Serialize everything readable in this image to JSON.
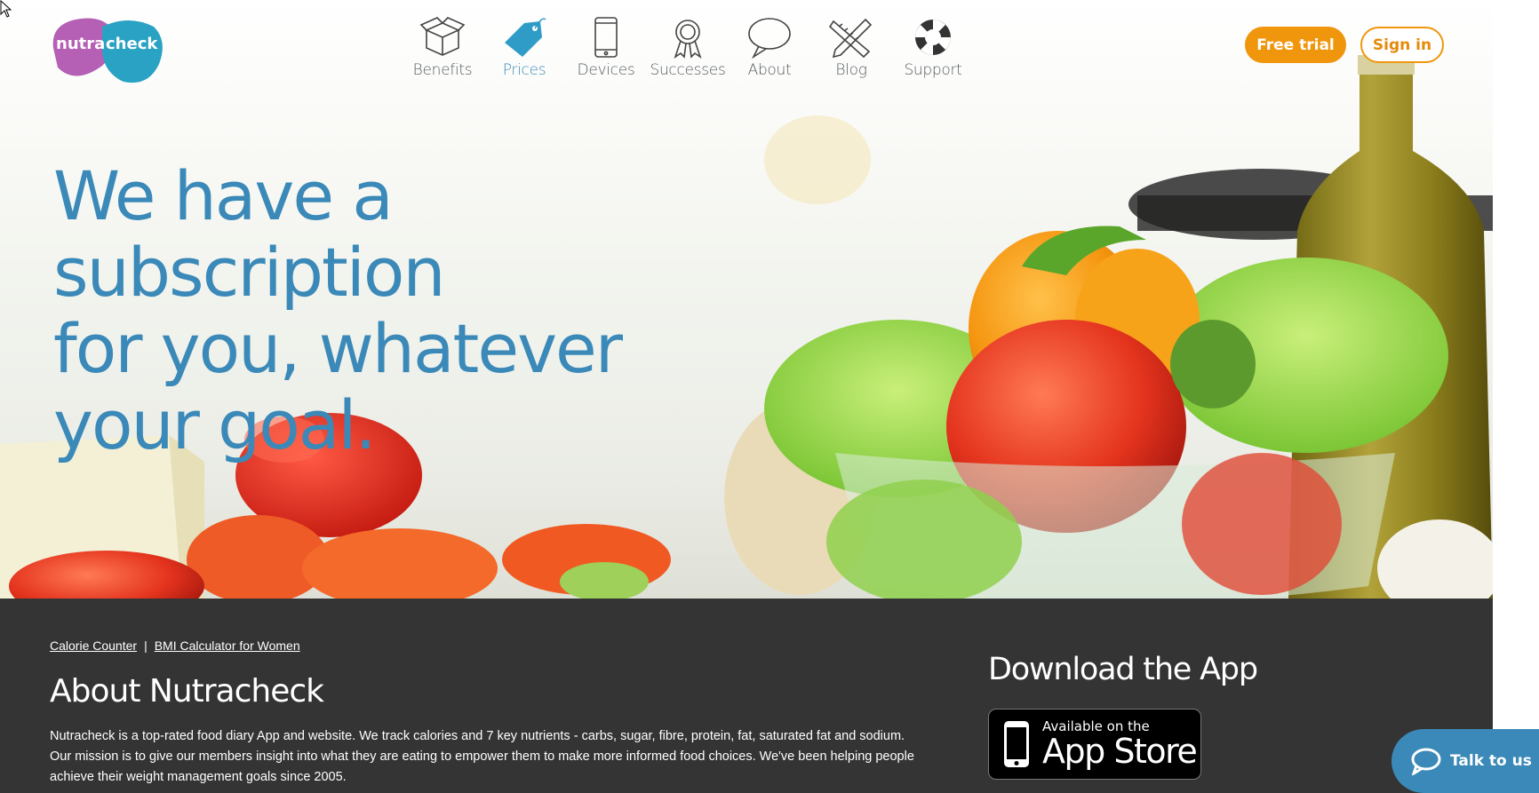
{
  "brand": {
    "logo_left": "nutra",
    "logo_right": "check"
  },
  "nav": {
    "items": [
      {
        "label": "Benefits",
        "icon": "box-icon"
      },
      {
        "label": "Prices",
        "icon": "price-tag-icon",
        "active": true
      },
      {
        "label": "Devices",
        "icon": "phone-icon"
      },
      {
        "label": "Successes",
        "icon": "award-ribbon-icon"
      },
      {
        "label": "About",
        "icon": "speech-bubble-icon"
      },
      {
        "label": "Blog",
        "icon": "pencil-ruler-icon"
      },
      {
        "label": "Support",
        "icon": "lifebuoy-icon"
      }
    ]
  },
  "header": {
    "free_trial_label": "Free trial",
    "sign_in_label": "Sign in"
  },
  "hero": {
    "headline_lines": [
      "We have a subscription",
      "for you, whatever",
      "your goal."
    ]
  },
  "footer": {
    "links": [
      "Calorie Counter",
      "BMI Calculator for Women"
    ],
    "link_separator": "|",
    "about_title": "About Nutracheck",
    "about_body": "Nutracheck is a top-rated food diary App and website. We track calories and 7 key nutrients - carbs, sugar, fibre, protein, fat, saturated fat and sodium. Our mission is to give our members insight into what they are eating to empower them to make more informed food choices. We've been helping people achieve their weight management goals since 2005.",
    "download_title": "Download the App",
    "appstore_small": "Available on the",
    "appstore_big": "App Store"
  },
  "chat": {
    "label": "Talk to us",
    "icon": "chat-bubble-icon"
  },
  "colors": {
    "brand_blue": "#3a89b8",
    "accent_orange": "#f0960d",
    "footer_bg": "#343434",
    "logo_purple": "#b55fb5",
    "logo_teal": "#2aa2c3"
  }
}
